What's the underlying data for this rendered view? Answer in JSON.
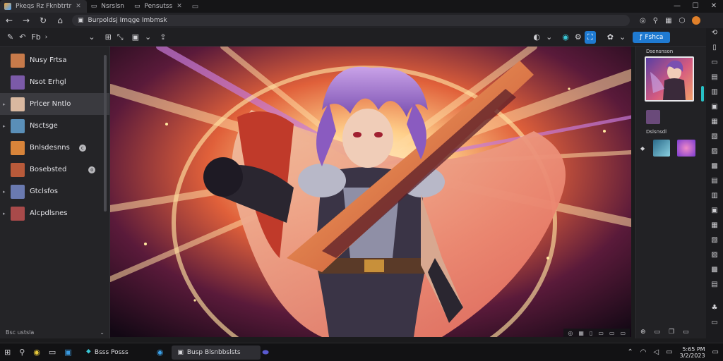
{
  "browser": {
    "tabs": [
      {
        "label": "Pkeqs Rz Fknbtrtr",
        "active": true
      },
      {
        "label": "Nsrslsn",
        "active": false
      },
      {
        "label": "Pensutss",
        "active": false
      }
    ],
    "url": "Burpoldsj Imqge Imbmsk",
    "window_controls": [
      "—",
      "☐",
      "✕"
    ]
  },
  "toolbar": {
    "tool_label": "Fb",
    "share_label": "Fshca"
  },
  "layers": [
    {
      "label": "Nusy Frtsa",
      "thumb": "#c77a4a",
      "selected": false,
      "badge": ""
    },
    {
      "label": "Nsot Erhgl",
      "thumb": "#7b5aa8",
      "selected": false,
      "badge": ""
    },
    {
      "label": "Prlcer Nntlo",
      "thumb": "#d9b8a0",
      "selected": true,
      "badge": ""
    },
    {
      "label": "Nsctsge",
      "thumb": "#5a8fb8",
      "selected": false,
      "badge": ""
    },
    {
      "label": "Bnlsdesnns",
      "thumb": "#d8843a",
      "selected": false,
      "badge": "c"
    },
    {
      "label": "Bosebsted",
      "thumb": "#b85a3a",
      "selected": false,
      "badge": "o"
    },
    {
      "label": "Gtclsfos",
      "thumb": "#6a7ab0",
      "selected": false,
      "badge": ""
    },
    {
      "label": "Alcpdlsnes",
      "thumb": "#a84a4a",
      "selected": false,
      "badge": ""
    }
  ],
  "left_footer": "Bsc ustsla",
  "right_panel": {
    "label_top": "Dsensnson",
    "label_mid": "Dslsnsdl"
  },
  "taskbar": {
    "apps": [
      {
        "label": "Bsss Posss",
        "active": false
      },
      {
        "label": "Busp Blsnbbslsts",
        "active": true
      }
    ],
    "clock_time": "5:65 PM",
    "clock_date": "3/2/2023"
  },
  "colors": {
    "accent": "#1f7ad1",
    "teal": "#28c1c6",
    "panel": "#242427",
    "canvas_glow": "#ffcf8a"
  }
}
